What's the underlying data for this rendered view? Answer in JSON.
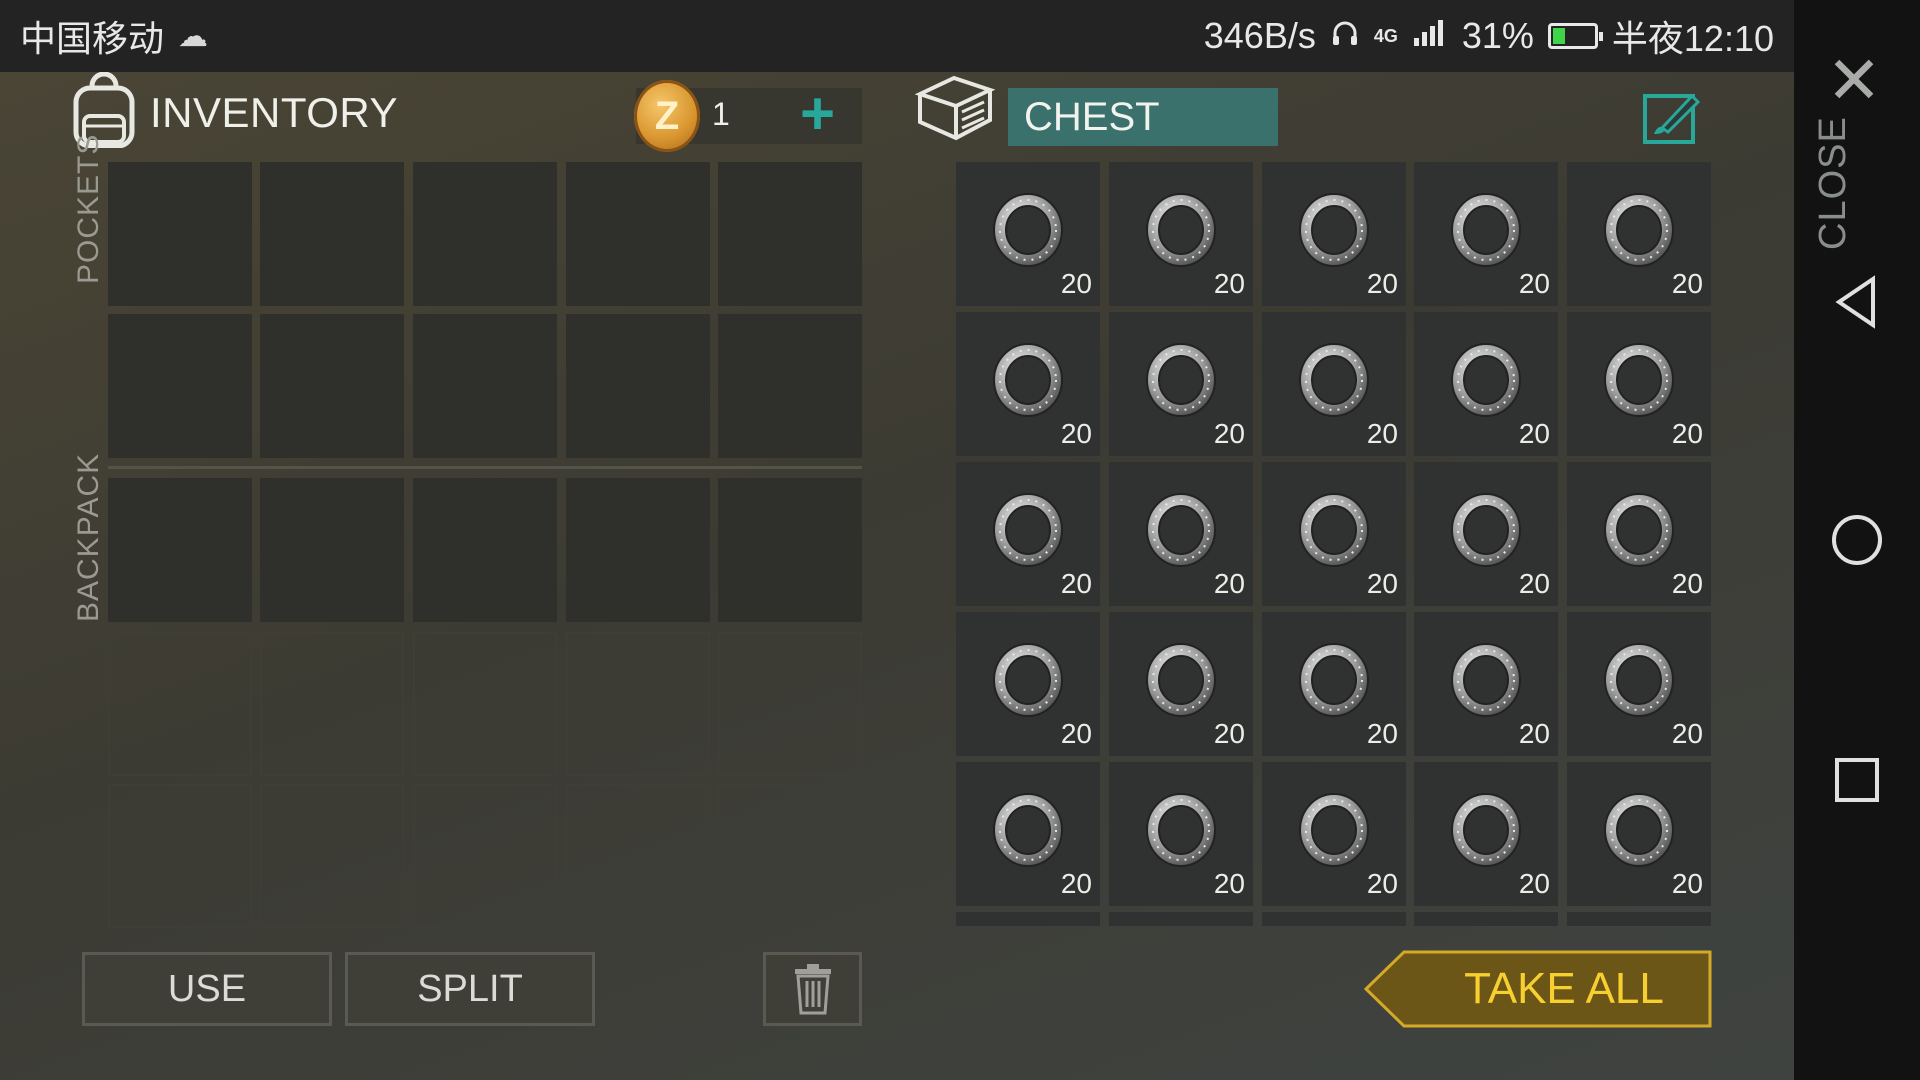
{
  "status_bar": {
    "carrier": "中国移动",
    "net_speed": "346B/s",
    "network_type": "4G",
    "battery": "31%",
    "battery_level": 0.31,
    "time": "半夜12:10"
  },
  "inventory": {
    "title": "INVENTORY",
    "coins": "1",
    "coin_symbol": "Z",
    "pockets_label": "POCKETS",
    "backpack_label": "BACKPACK"
  },
  "chest": {
    "title": "CHEST",
    "item_icon": "bearing-ring-icon",
    "rows": [
      [
        "20",
        "20",
        "20",
        "20",
        "20"
      ],
      [
        "20",
        "20",
        "20",
        "20",
        "20"
      ],
      [
        "20",
        "20",
        "20",
        "20",
        "20"
      ],
      [
        "20",
        "20",
        "20",
        "20",
        "20"
      ],
      [
        "20",
        "20",
        "20",
        "20",
        "20"
      ]
    ]
  },
  "actions": {
    "use": "USE",
    "split": "SPLIT",
    "take_all": "TAKE ALL"
  },
  "sidebar": {
    "close": "CLOSE"
  },
  "colors": {
    "accent_teal": "#27a89a",
    "chest_header": "#3a716c",
    "take_all_gold": "#b8901c",
    "take_all_text": "#f7d030"
  }
}
